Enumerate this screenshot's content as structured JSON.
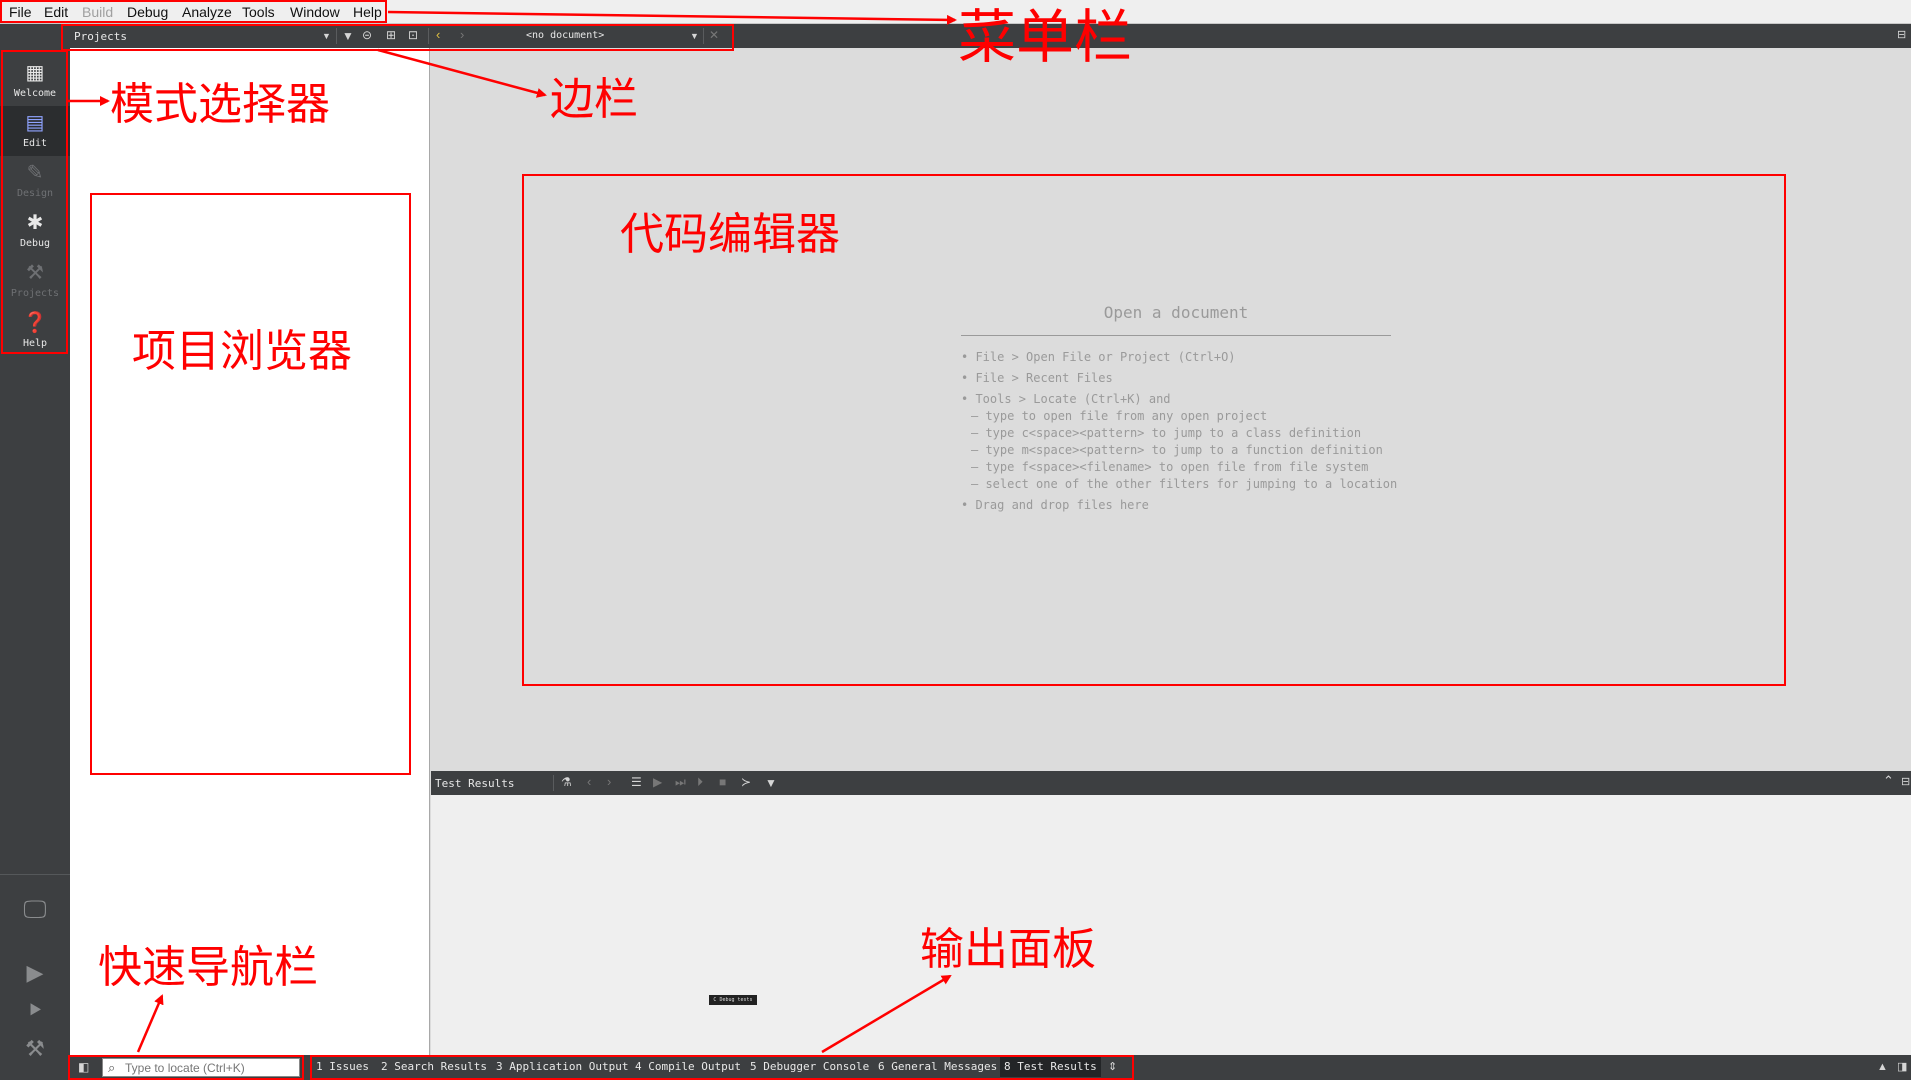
{
  "menu": {
    "items": [
      {
        "label": "File",
        "enabled": true
      },
      {
        "label": "Edit",
        "enabled": true
      },
      {
        "label": "Build",
        "enabled": false
      },
      {
        "label": "Debug",
        "enabled": true
      },
      {
        "label": "Analyze",
        "enabled": true
      },
      {
        "label": "Tools",
        "enabled": true
      },
      {
        "label": "Window",
        "enabled": true
      },
      {
        "label": "Help",
        "enabled": true
      }
    ]
  },
  "sidebar": {
    "view_selector": "Projects"
  },
  "editor_toolbar": {
    "document_selector": "<no document>"
  },
  "modes": [
    {
      "label": "Welcome",
      "icon": "grid-icon",
      "enabled": true
    },
    {
      "label": "Edit",
      "icon": "document-icon",
      "enabled": true,
      "active": true
    },
    {
      "label": "Design",
      "icon": "pencil-icon",
      "enabled": false
    },
    {
      "label": "Debug",
      "icon": "bug-icon",
      "enabled": true
    },
    {
      "label": "Projects",
      "icon": "wrench-icon",
      "enabled": false
    },
    {
      "label": "Help",
      "icon": "help-icon",
      "enabled": true
    }
  ],
  "editor": {
    "title": "Open a document",
    "hints": [
      "• File > Open File or Project (Ctrl+O)",
      "• File > Recent Files",
      "• Tools > Locate (Ctrl+K) and",
      "– type to open file from any open project",
      "– type c<space><pattern> to jump to a class definition",
      "– type m<space><pattern> to jump to a function definition",
      "– type f<space><filename> to open file from file system",
      "– select one of the other filters for jumping to a location",
      "• Drag and drop files here"
    ]
  },
  "output_panel": {
    "title": "Test Results",
    "tooltip": "C Debug tests"
  },
  "statusbar": {
    "locator_placeholder": "Type to locate (Ctrl+K)",
    "tabs": [
      {
        "label": "1  Issues"
      },
      {
        "label": "2  Search Results"
      },
      {
        "label": "3  Application Output"
      },
      {
        "label": "4  Compile Output"
      },
      {
        "label": "5  Debugger Console"
      },
      {
        "label": "6  General Messages"
      },
      {
        "label": "8  Test Results",
        "active": true
      }
    ]
  },
  "annotations": {
    "menu_bar": "菜单栏",
    "sidebar": "边栏",
    "mode_selector": "模式选择器",
    "code_editor": "代码编辑器",
    "project_browser": "项目浏览器",
    "quick_nav": "快速导航栏",
    "output_panel": "输出面板"
  },
  "colors": {
    "annotation": "#ff0000",
    "dark_panel": "#3d3f41",
    "editor_bg": "#dcdcdc"
  }
}
